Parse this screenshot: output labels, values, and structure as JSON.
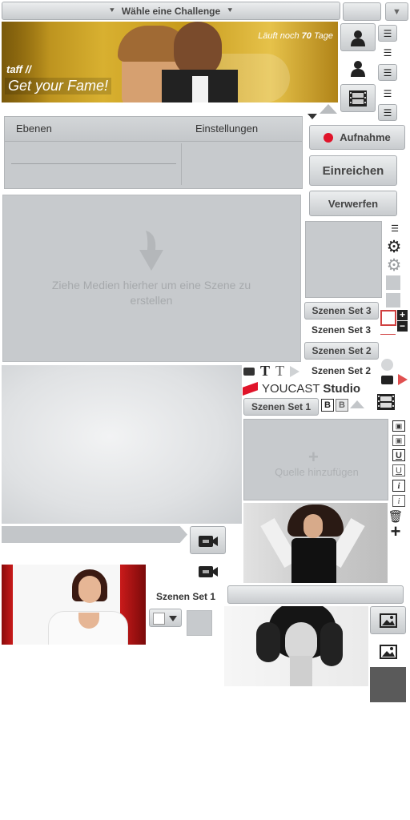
{
  "challenge_dropdown": {
    "label": "Wähle eine Challenge"
  },
  "banner": {
    "remaining_prefix": "Läuft noch",
    "remaining_days": "70",
    "remaining_suffix": "Tage",
    "show": "taff //",
    "slogan": "Get your Fame!"
  },
  "panels_header": {
    "layers_tab": "Ebenen",
    "settings_tab": "Einstellungen"
  },
  "actions": {
    "record_label": "Aufnahme",
    "submit_label": "Einreichen",
    "discard_label": "Verwerfen"
  },
  "drop_zone": {
    "text": "Ziehe Medien hierher um eine Szene zu erstellen"
  },
  "scene_sets": {
    "set3_button": "Szenen Set 3",
    "set3_label": "Szenen Set 3",
    "set2_button": "Szenen Set 2",
    "set2_label": "Szenen Set 2",
    "set1_tab": "Szenen Set 1",
    "set1_label": "Szenen Set 1"
  },
  "branding": {
    "brand": "YOUCAST",
    "suffix": "Studio"
  },
  "source": {
    "add_label": "Quelle hinzufügen"
  },
  "format_buttons": {
    "bold": "B",
    "bold2": "B"
  },
  "icons": [
    "person-icon",
    "align-icon",
    "film-icon",
    "record-dot-icon",
    "gear-icon",
    "plus-icon",
    "minus-icon",
    "camera-icon",
    "image-icon",
    "underline-icon",
    "italic-icon",
    "trash-icon",
    "text-icon",
    "play-icon",
    "chevron-down-icon"
  ],
  "colors": {
    "accent_red": "#e0142a",
    "panel_gray": "#c7cacd",
    "play_red": "#e05050"
  }
}
